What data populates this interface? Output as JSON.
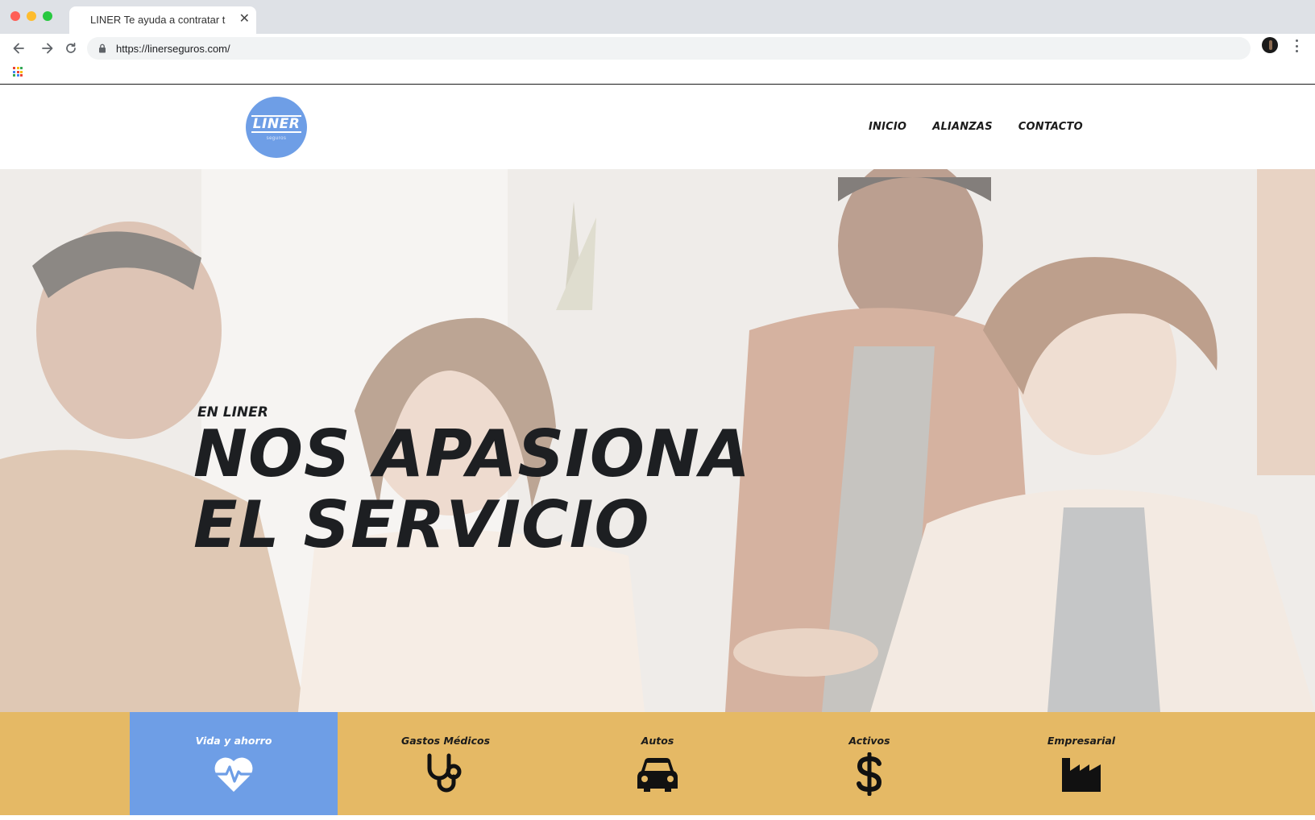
{
  "browser": {
    "tab_title": "LINER Te ayuda a contratar t",
    "tab_close": "✕",
    "url": "https://linerseguros.com/"
  },
  "site": {
    "logo": {
      "word": "LINER",
      "sub": "seguros"
    },
    "nav": [
      {
        "label": "INICIO"
      },
      {
        "label": "ALIANZAS"
      },
      {
        "label": "CONTACTO"
      }
    ],
    "hero": {
      "kicker": "EN LINER",
      "title_line1": "NOS APASIONA",
      "title_line2": "EL SERVICIO"
    },
    "services": [
      {
        "label": "Vida y ahorro",
        "icon": "heartbeat-icon",
        "active": true
      },
      {
        "label": "Gastos Médicos",
        "icon": "stethoscope-icon",
        "active": false
      },
      {
        "label": "Autos",
        "icon": "car-icon",
        "active": false
      },
      {
        "label": "Activos",
        "icon": "dollar-icon",
        "active": false
      },
      {
        "label": "Empresarial",
        "icon": "factory-icon",
        "active": false
      }
    ]
  },
  "colors": {
    "brand_blue": "#6e9ee6",
    "services_bar": "#e5b965",
    "text_dark": "#1d1f22"
  }
}
